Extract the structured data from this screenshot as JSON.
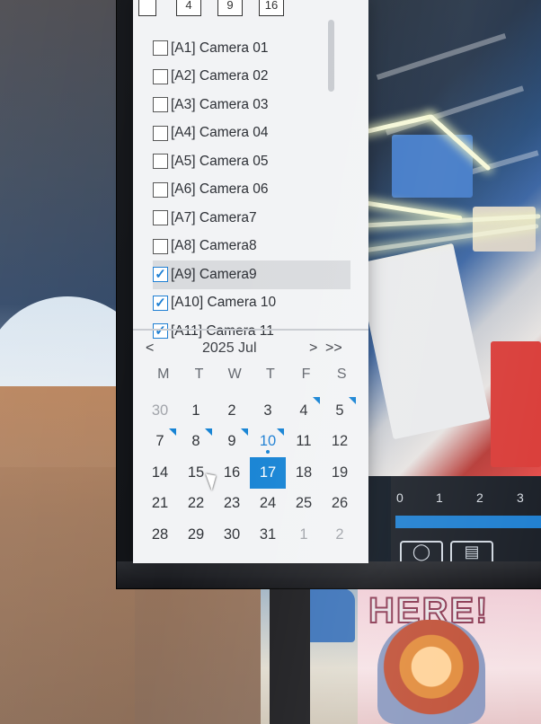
{
  "page_tabs": [
    "4",
    "9",
    "16"
  ],
  "cameras": [
    {
      "label": "[A1] Camera 01",
      "checked": false
    },
    {
      "label": "[A2] Camera 02",
      "checked": false
    },
    {
      "label": "[A3] Camera 03",
      "checked": false
    },
    {
      "label": "[A4] Camera 04",
      "checked": false
    },
    {
      "label": "[A5] Camera 05",
      "checked": false
    },
    {
      "label": "[A6] Camera 06",
      "checked": false
    },
    {
      "label": "[A7] Camera7",
      "checked": false
    },
    {
      "label": "[A8] Camera8",
      "checked": false
    },
    {
      "label": "[A9] Camera9",
      "checked": true
    },
    {
      "label": "[A10] Camera 10",
      "checked": true
    },
    {
      "label": "[A11] Camera 11",
      "checked": true
    }
  ],
  "calendar": {
    "prev_label": "<",
    "month_label": "2025 Jul",
    "next_label": ">",
    "next_year_label": ">>",
    "weekdays": [
      "M",
      "T",
      "W",
      "T",
      "F",
      "S"
    ],
    "weeks": [
      [
        {
          "d": "30",
          "other": true
        },
        {
          "d": "1"
        },
        {
          "d": "2"
        },
        {
          "d": "3"
        },
        {
          "d": "4",
          "rec": true
        },
        {
          "d": "5",
          "rec": true
        }
      ],
      [
        {
          "d": "7",
          "rec": true
        },
        {
          "d": "8",
          "rec": true
        },
        {
          "d": "9",
          "rec": true
        },
        {
          "d": "10",
          "rec": true,
          "today": true
        },
        {
          "d": "11"
        },
        {
          "d": "12"
        }
      ],
      [
        {
          "d": "14"
        },
        {
          "d": "15"
        },
        {
          "d": "16"
        },
        {
          "d": "17",
          "selected": true
        },
        {
          "d": "18"
        },
        {
          "d": "19"
        }
      ],
      [
        {
          "d": "21"
        },
        {
          "d": "22"
        },
        {
          "d": "23"
        },
        {
          "d": "24"
        },
        {
          "d": "25"
        },
        {
          "d": "26"
        }
      ],
      [
        {
          "d": "28"
        },
        {
          "d": "29"
        },
        {
          "d": "30"
        },
        {
          "d": "31"
        },
        {
          "d": "1",
          "other": true
        },
        {
          "d": "2",
          "other": true
        }
      ]
    ],
    "accent_color": "#1683d4"
  },
  "timeline": {
    "ticks": [
      "0",
      "1",
      "2",
      "3"
    ],
    "icons": [
      "person-icon",
      "vehicle-icon"
    ]
  },
  "scene": {
    "poster_text": "HERE!"
  }
}
